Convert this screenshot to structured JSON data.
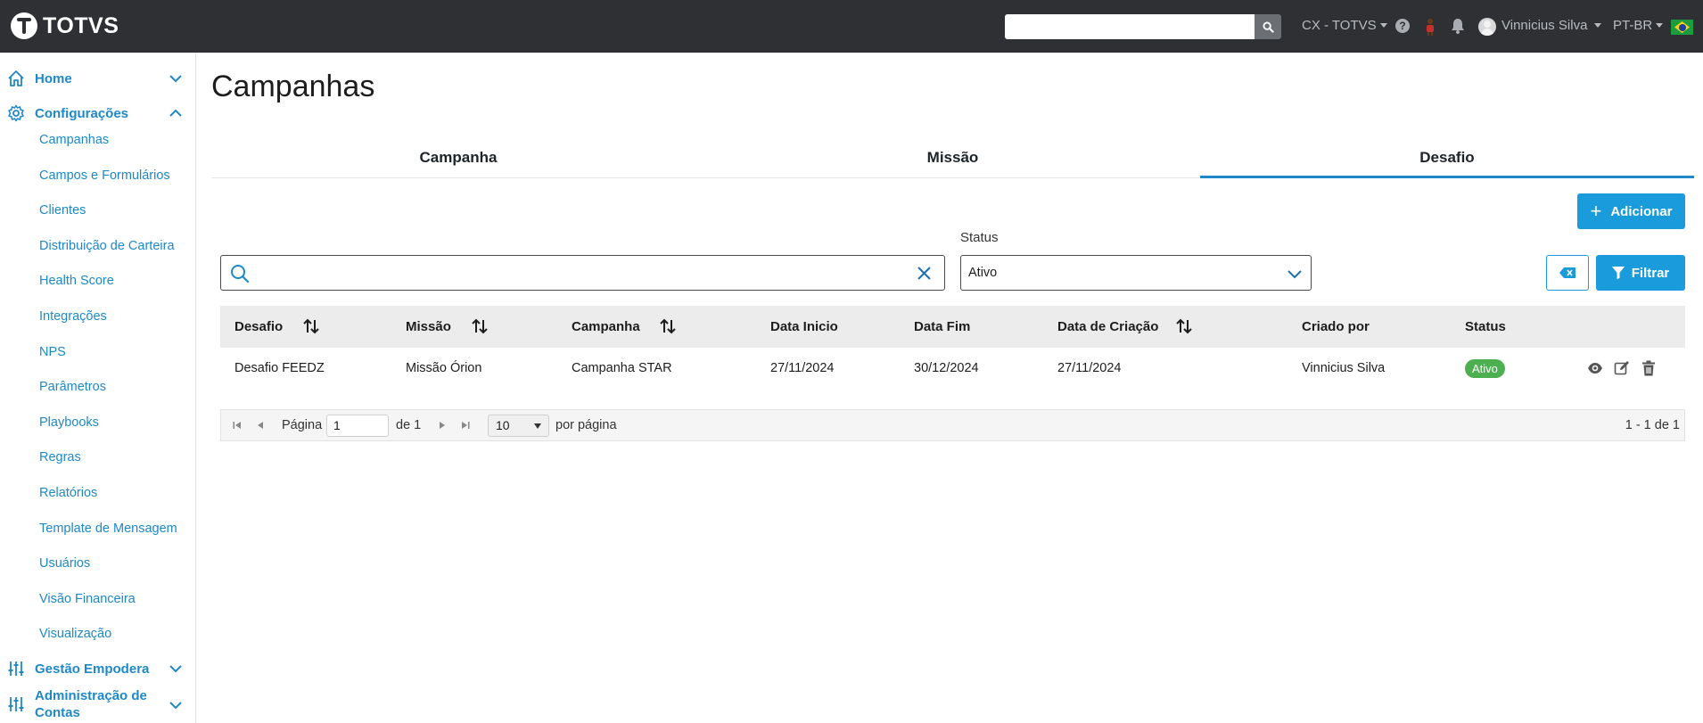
{
  "topbar": {
    "logo_text": "TOTVS",
    "search_placeholder": "",
    "company": "CX - TOTVS",
    "user": "Vinnicius Silva",
    "language": "PT-BR"
  },
  "sidebar": {
    "groups": [
      {
        "label": "Home",
        "icon": "home-icon",
        "expanded": false
      },
      {
        "label": "Configurações",
        "icon": "gear-icon",
        "expanded": true
      },
      {
        "label": "Gestão Empodera",
        "icon": "sliders-icon",
        "expanded": false
      },
      {
        "label": "Administração de Contas",
        "icon": "sliders-icon",
        "expanded": false
      }
    ],
    "config_items": [
      "Campanhas",
      "Campos e Formulários",
      "Clientes",
      "Distribuição de Carteira",
      "Health Score",
      "Integrações",
      "NPS",
      "Parâmetros",
      "Playbooks",
      "Regras",
      "Relatórios",
      "Template de Mensagem",
      "Usuários",
      "Visão Financeira",
      "Visualização"
    ]
  },
  "page": {
    "title": "Campanhas",
    "tabs": [
      {
        "label": "Campanha",
        "active": false
      },
      {
        "label": "Missão",
        "active": false
      },
      {
        "label": "Desafio",
        "active": true
      }
    ],
    "add_button": "Adicionar",
    "filter_button": "Filtrar",
    "status_label": "Status",
    "status_value": "Ativo",
    "search_value": ""
  },
  "table": {
    "columns": [
      "Desafio",
      "Missão",
      "Campanha",
      "Data Inicio",
      "Data Fim",
      "Data de Criação",
      "Criado por",
      "Status"
    ],
    "rows": [
      {
        "desafio": "Desafio FEEDZ",
        "missao": "Missão Órion",
        "campanha": "Campanha STAR",
        "data_inicio": "27/11/2024",
        "data_fim": "30/12/2024",
        "data_criacao": "27/11/2024",
        "criado_por": "Vinnicius Silva",
        "status": "Ativo"
      }
    ]
  },
  "pagination": {
    "page_label": "Página",
    "page_value": "1",
    "of_label": "de 1",
    "page_size": "10",
    "per_page_label": "por página",
    "range_text": "1 - 1 de 1"
  },
  "colors": {
    "topbar": "#2e3033",
    "accent": "#1a9bdb",
    "link": "#1e88c8",
    "badge_active": "#4caf50"
  }
}
